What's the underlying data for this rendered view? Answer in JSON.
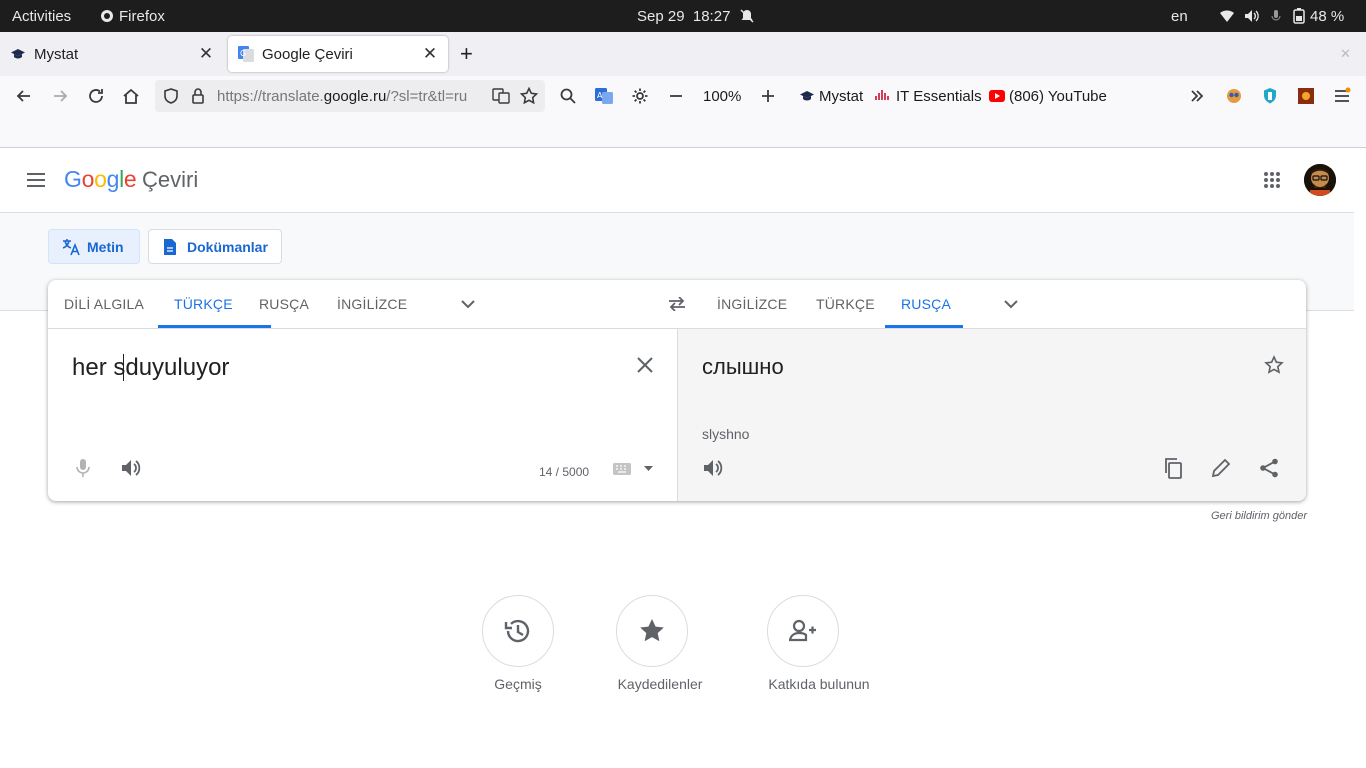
{
  "system_bar": {
    "activities": "Activities",
    "app_name": "Firefox",
    "datetime": "Sep 29  18:27",
    "keyboard_layout": "en",
    "battery": "48 %"
  },
  "tabs": [
    {
      "label": "Mystat",
      "active": false
    },
    {
      "label": "Google Çeviri",
      "active": true
    }
  ],
  "toolbar": {
    "url_prefix": "https://translate.",
    "url_domain": "google.ru",
    "url_rest": "/?sl=tr&tl=ru",
    "zoom": "100%",
    "bookmarks": [
      "Mystat",
      "IT Essentials",
      "(806) YouTube"
    ]
  },
  "app": {
    "brand": "Google",
    "product": "Çeviri",
    "modes": [
      "Metin",
      "Dokümanlar"
    ],
    "source_langs": [
      "DİLİ ALGILA",
      "TÜRKÇE",
      "RUSÇA",
      "İNGİLİZCE"
    ],
    "target_langs": [
      "İNGİLİZCE",
      "TÜRKÇE",
      "RUSÇA"
    ],
    "source_text": "her sduyuluyor",
    "char_count": "14 / 5000",
    "translation": "слышно",
    "transliteration": "slyshno",
    "feedback": "Geri bildirim gönder",
    "bottom_actions": [
      "Geçmiş",
      "Kaydedilenler",
      "Katkıda bulunun"
    ]
  },
  "colors": {
    "accent": "#1a73e8",
    "google_blue": "#4285f4",
    "google_red": "#ea4335",
    "google_yellow": "#fbbc05",
    "google_green": "#34a853"
  }
}
